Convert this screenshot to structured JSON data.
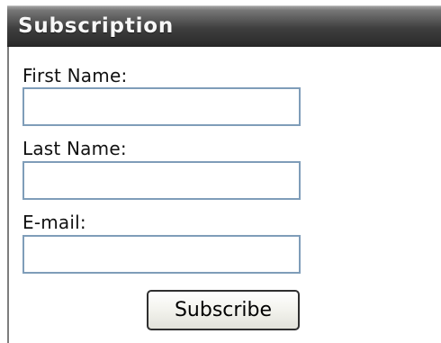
{
  "subscription": {
    "title": "Subscription",
    "fields": [
      {
        "label": "First Name:",
        "value": "",
        "placeholder": ""
      },
      {
        "label": "Last Name:",
        "value": "",
        "placeholder": ""
      },
      {
        "label": "E-mail:",
        "value": "",
        "placeholder": ""
      }
    ],
    "submit_label": "Subscribe"
  },
  "colors": {
    "header_background": "#3f3f3f",
    "header_text": "#f7f7f7",
    "input_border": "#7f9db9",
    "button_border": "#2f2f2f",
    "page_background": "#ffffff"
  }
}
